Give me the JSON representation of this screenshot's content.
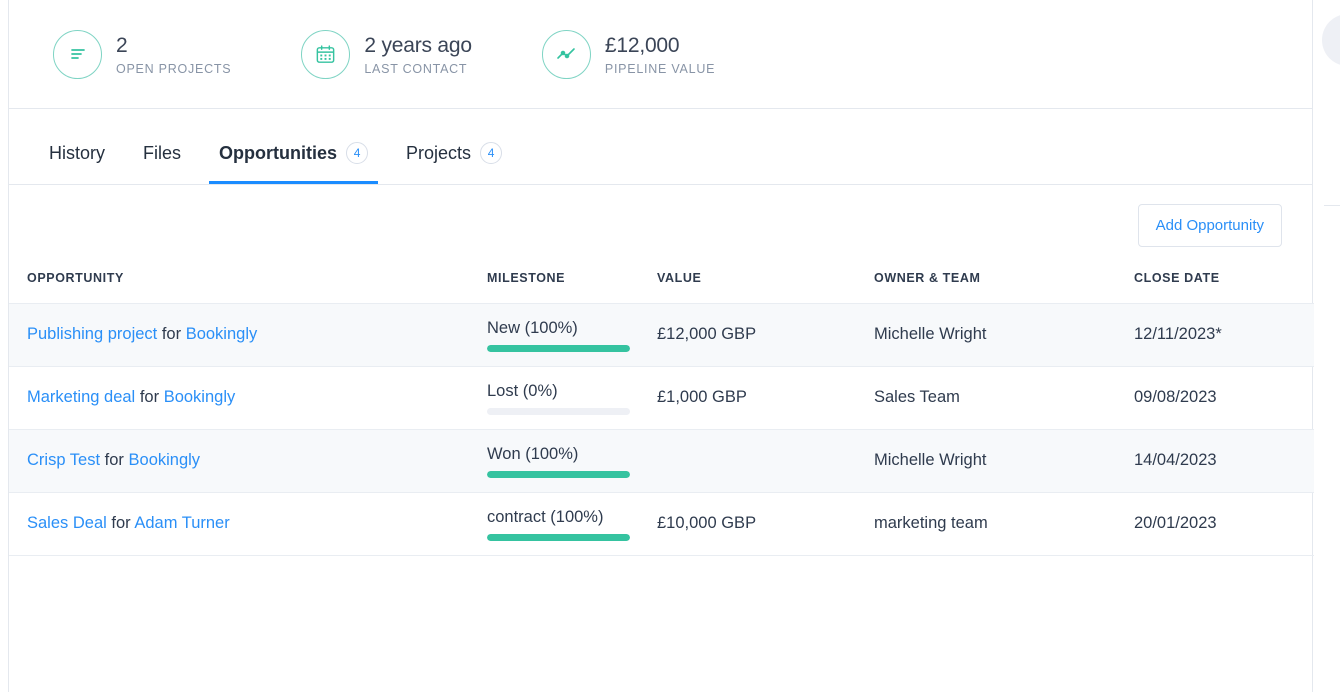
{
  "stats": [
    {
      "icon": "bars-list-icon",
      "value": "2",
      "label": "OPEN PROJECTS"
    },
    {
      "icon": "calendar-icon",
      "value": "2 years ago",
      "label": "LAST CONTACT"
    },
    {
      "icon": "line-chart-icon",
      "value": "£12,000",
      "label": "PIPELINE VALUE"
    }
  ],
  "tabs": [
    {
      "label": "History",
      "badge": "",
      "active": false
    },
    {
      "label": "Files",
      "badge": "",
      "active": false
    },
    {
      "label": "Opportunities",
      "badge": "4",
      "active": true
    },
    {
      "label": "Projects",
      "badge": "4",
      "active": false
    }
  ],
  "toolbar": {
    "add_opportunity_label": "Add Opportunity"
  },
  "table": {
    "headers": [
      "OPPORTUNITY",
      "MILESTONE",
      "VALUE",
      "OWNER & TEAM",
      "CLOSE DATE"
    ],
    "rows": [
      {
        "name": "Publishing project",
        "for_word": "for",
        "account": "Bookingly",
        "milestone": "New (100%)",
        "progress": 100,
        "value": "£12,000 GBP",
        "owner": "Michelle Wright",
        "close_date": "12/11/2023*"
      },
      {
        "name": "Marketing deal",
        "for_word": "for",
        "account": "Bookingly",
        "milestone": "Lost (0%)",
        "progress": 0,
        "value": "£1,000 GBP",
        "owner": "Sales Team",
        "close_date": "09/08/2023"
      },
      {
        "name": "Crisp Test",
        "for_word": "for",
        "account": "Bookingly",
        "milestone": "Won (100%)",
        "progress": 100,
        "value": "",
        "owner": "Michelle Wright",
        "close_date": "14/04/2023"
      },
      {
        "name": "Sales Deal",
        "for_word": "for",
        "account": "Adam Turner",
        "milestone": "contract (100%)",
        "progress": 100,
        "value": "£10,000 GBP",
        "owner": "marketing team",
        "close_date": "20/01/2023"
      }
    ]
  },
  "right_panel": {
    "name": "",
    "link": ""
  },
  "colors": {
    "accent_blue": "#2a8ff7",
    "progress_green": "#35c3a0",
    "icon_teal": "#7fd4c4",
    "text_dark": "#2f3b4e",
    "row_alt_bg": "#f7f9fb",
    "border": "#e4e8ee"
  }
}
